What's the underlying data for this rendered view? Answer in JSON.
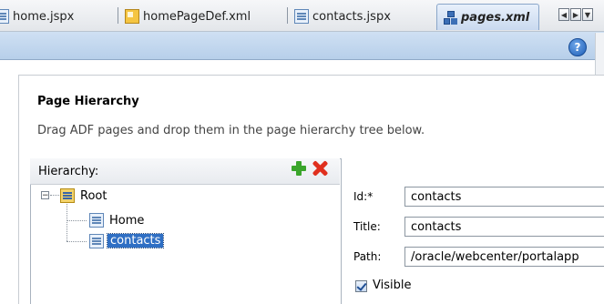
{
  "tabs": [
    {
      "label": "home.jspx",
      "icon": "jspx-file-icon",
      "active": false
    },
    {
      "label": "homePageDef.xml",
      "icon": "xml-file-icon",
      "active": false
    },
    {
      "label": "contacts.jspx",
      "icon": "jspx-file-icon",
      "active": false
    },
    {
      "label": "pages.xml",
      "icon": "page-hierarchy-icon",
      "active": true
    }
  ],
  "tab_nav": {
    "prev": "◀",
    "next": "▶",
    "menu": "▼"
  },
  "toolbar": {
    "help": "?"
  },
  "panel": {
    "heading": "Page Hierarchy",
    "instruction": "Drag ADF pages and drop them in the page hierarchy tree below."
  },
  "hierarchy": {
    "label": "Hierarchy:",
    "expander": "−",
    "root": "Root",
    "children": [
      "Home",
      "contacts"
    ],
    "selected": "contacts"
  },
  "form": {
    "id_label": "Id:*",
    "id_value": "contacts",
    "title_label": "Title:",
    "title_value": "contacts",
    "path_label": "Path:",
    "path_value": "/oracle/webcenter/portalapp",
    "visible_label": "Visible",
    "visible_checked": true
  },
  "colors": {
    "accent": "#2f6fc4",
    "toolbar": "#c3d7ee",
    "add": "#3aa52b",
    "delete": "#e0301e"
  }
}
